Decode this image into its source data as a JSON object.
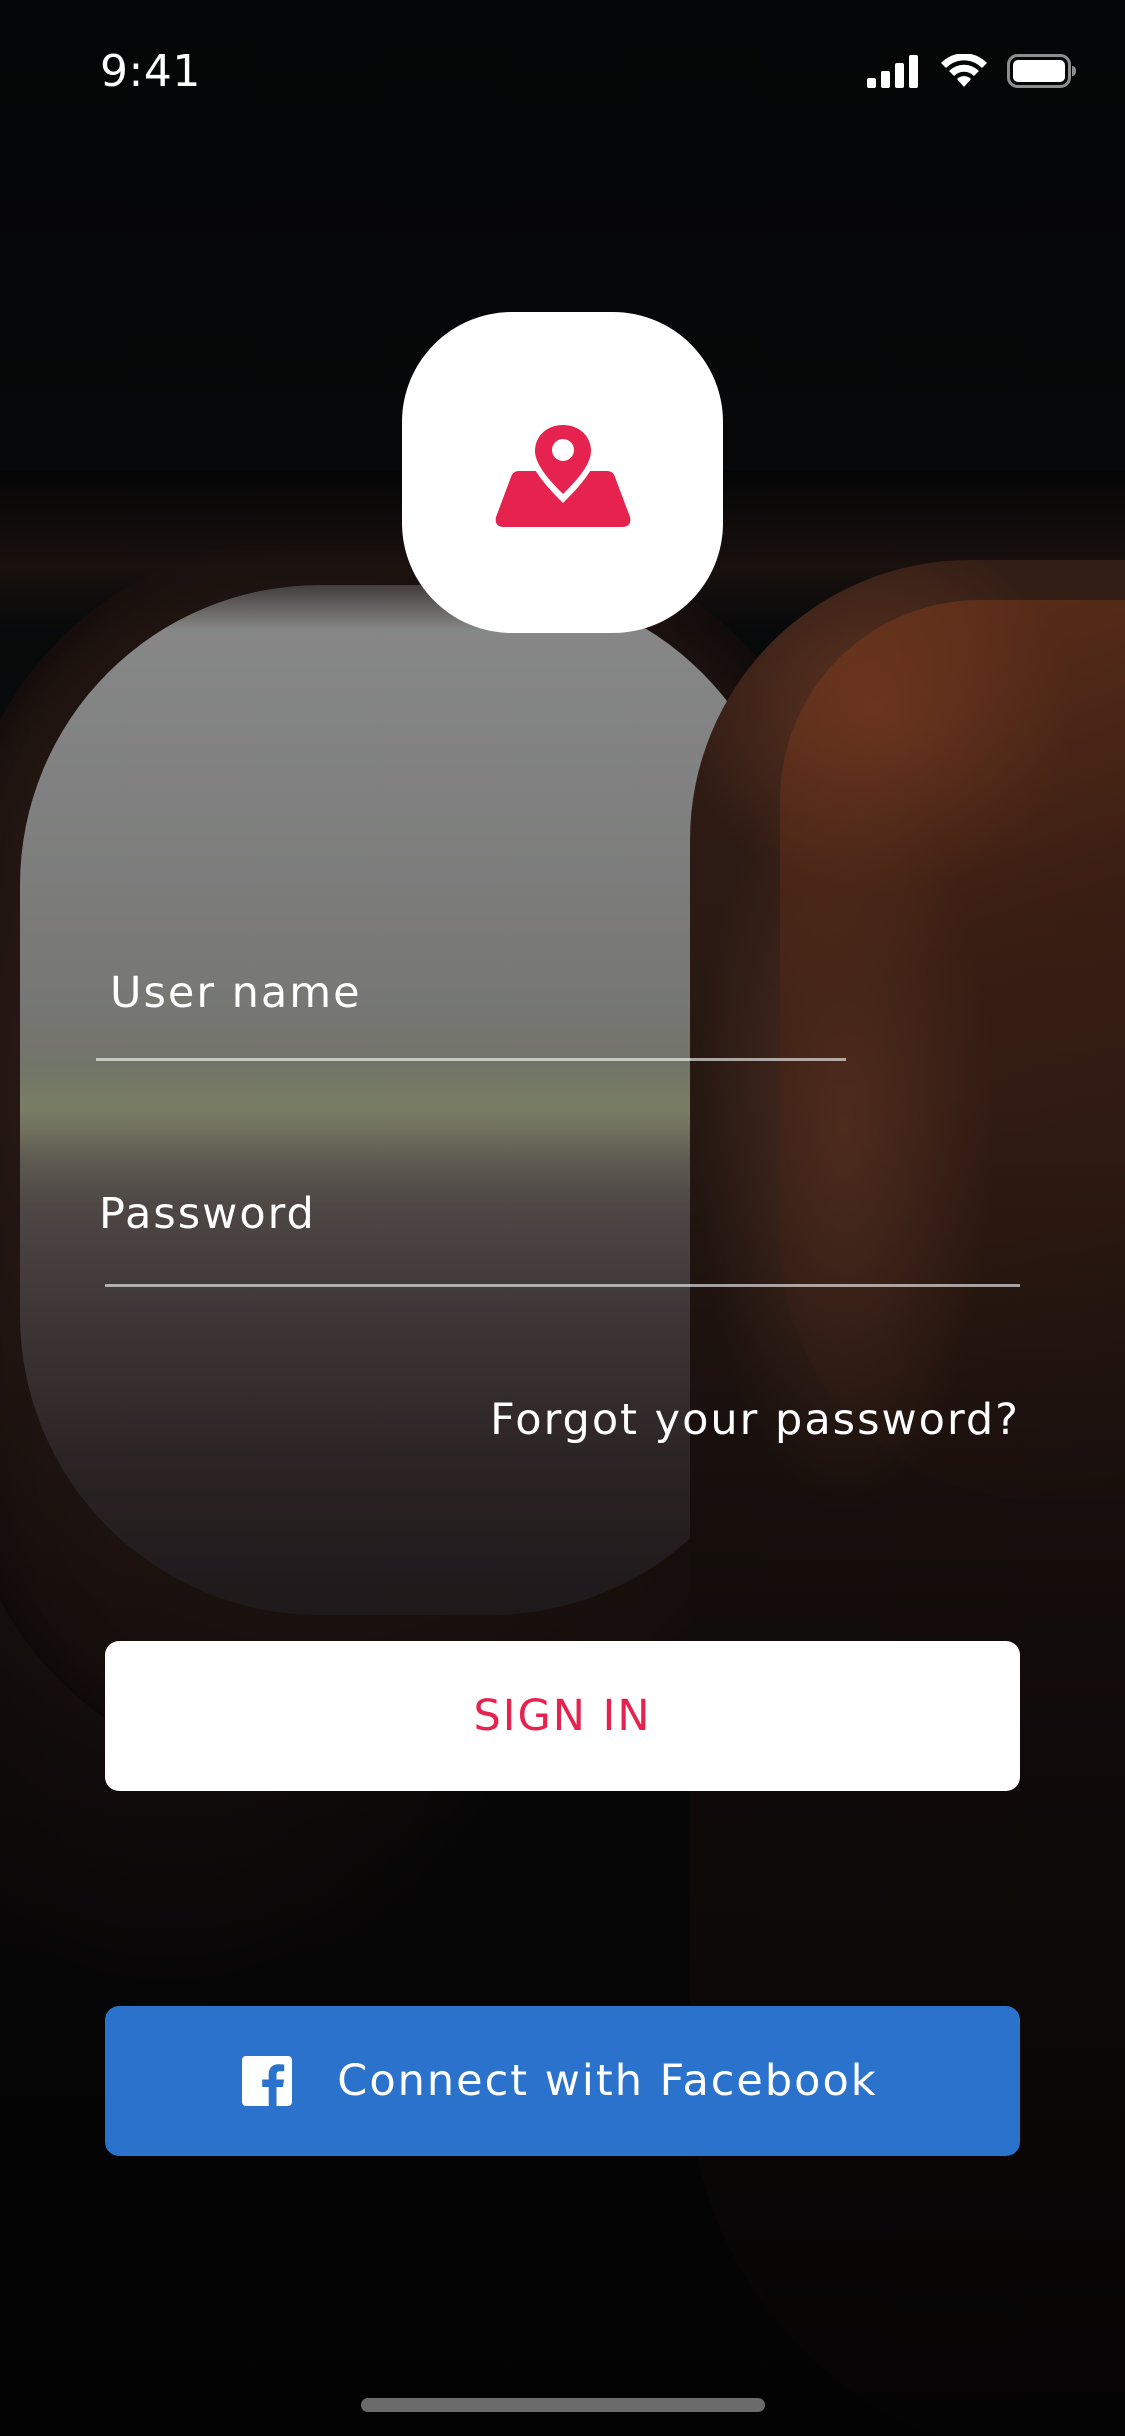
{
  "status_bar": {
    "time": "9:41"
  },
  "icons": {
    "logo": "map-location-pin-icon",
    "signal": "cellular-signal-icon",
    "wifi": "wifi-icon",
    "battery": "battery-icon",
    "facebook": "facebook-icon"
  },
  "login_form": {
    "username_placeholder": "User name",
    "password_placeholder": "Password",
    "forgot_password_link": "Forgot your password?",
    "sign_in_button": "SIGN IN",
    "facebook_button": "Connect with Facebook"
  },
  "colors": {
    "accent": "#e6224e",
    "facebook_blue": "#2a72cb",
    "tile_background": "#ffffff"
  }
}
